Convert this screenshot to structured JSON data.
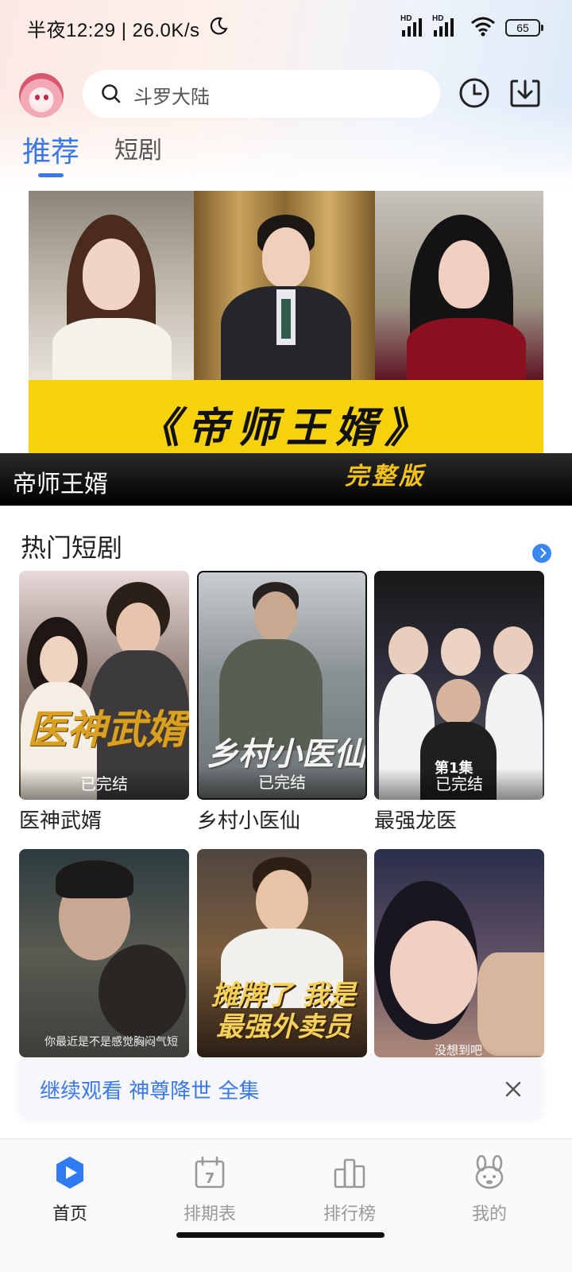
{
  "status_bar": {
    "time": "半夜12:29 | 26.0K/s",
    "hd1": "HD",
    "hd2": "HD",
    "battery": "65"
  },
  "header": {
    "search_placeholder": "斗罗大陆"
  },
  "tabs": [
    {
      "label": "推荐",
      "active": true
    },
    {
      "label": "短剧",
      "active": false
    }
  ],
  "banner": {
    "poster_title": "《帝师王婿》",
    "poster_edition": "完整版",
    "caption": "帝师王婿"
  },
  "section": {
    "title": "热门短剧"
  },
  "dramas": [
    {
      "name": "医神武婿",
      "status": "已完结",
      "poster_text": "医神武婿"
    },
    {
      "name": "乡村小医仙",
      "status": "已完结",
      "poster_text": "乡村小医仙"
    },
    {
      "name": "最强龙医",
      "status": "已完结",
      "poster_text": "第1集"
    },
    {
      "name": "",
      "status": "",
      "poster_text": "你最近是不是感觉胸闷气短"
    },
    {
      "name": "",
      "status": "",
      "poster_text": "摊牌了 我是最强外卖员"
    },
    {
      "name": "",
      "status": "",
      "poster_text": "没想到吧"
    }
  ],
  "continue_watching": {
    "text": "继续观看 神尊降世 全集"
  },
  "bottom_nav": [
    {
      "label": "首页",
      "active": true
    },
    {
      "label": "排期表",
      "active": false,
      "icon_text": "7"
    },
    {
      "label": "排行榜",
      "active": false
    },
    {
      "label": "我的",
      "active": false
    }
  ],
  "colors": {
    "accent": "#3a78ea",
    "banner_strip": "#f6d20c",
    "edition_text": "#f2c21a"
  }
}
